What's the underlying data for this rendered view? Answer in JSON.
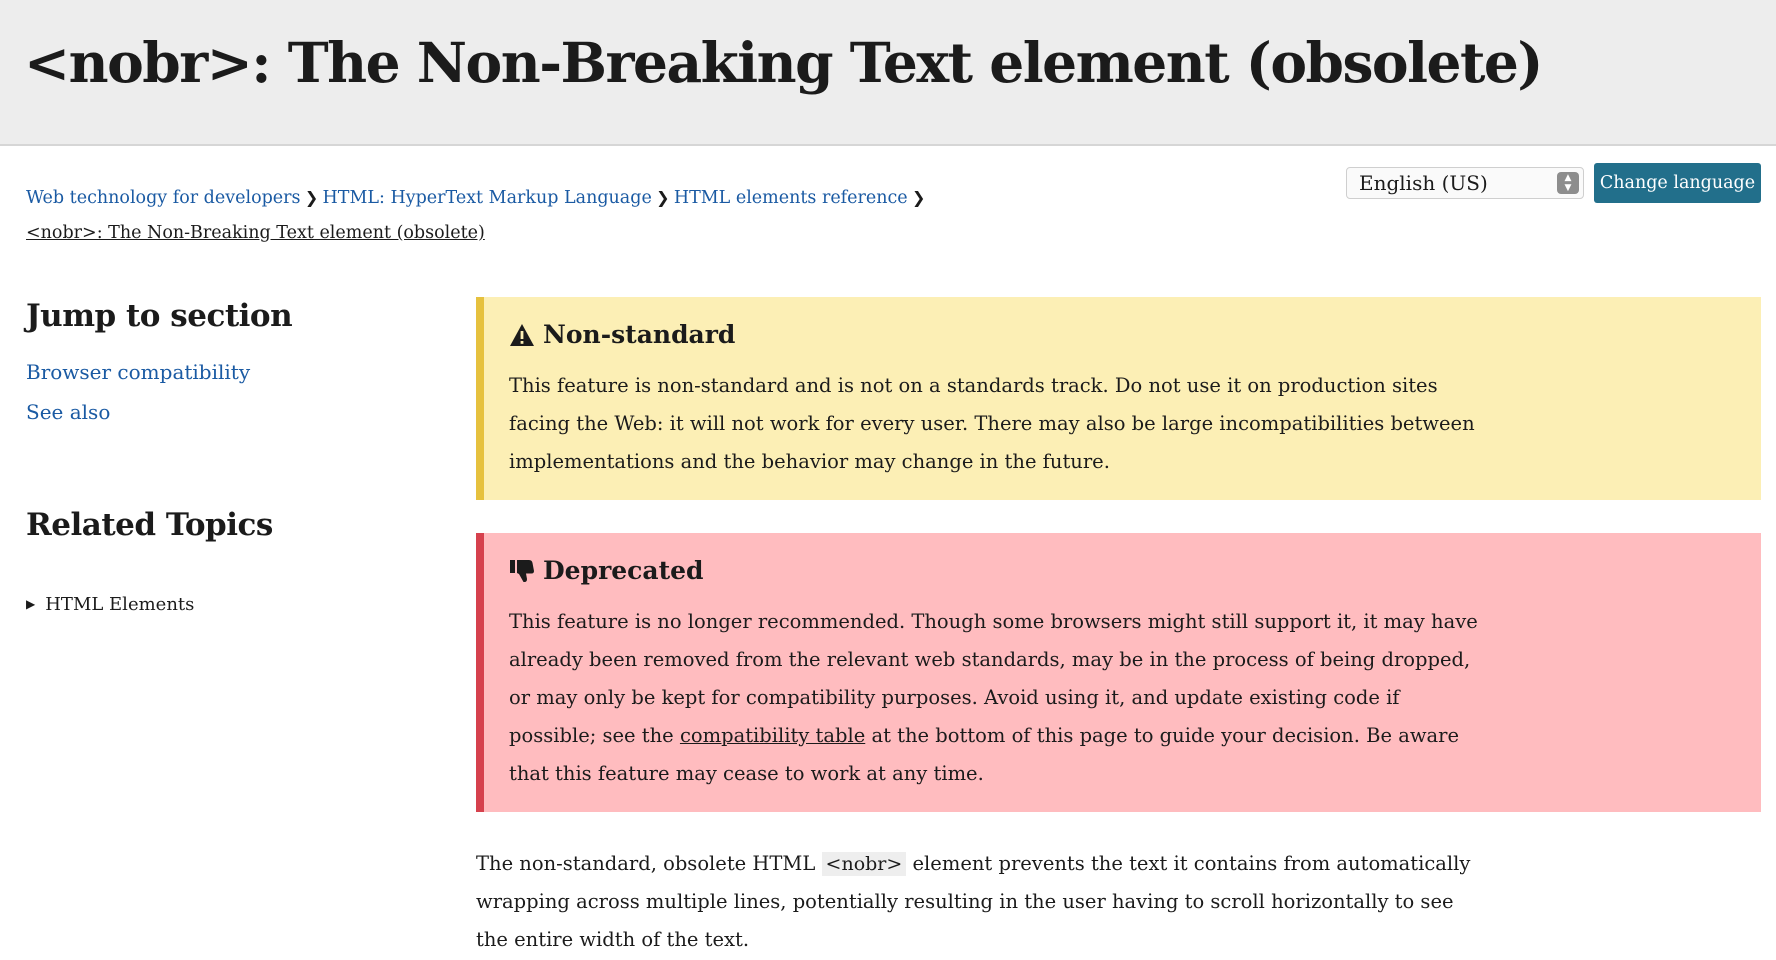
{
  "page": {
    "title": "<nobr>: The Non-Breaking Text element (obsolete)"
  },
  "breadcrumb": {
    "items": [
      "Web technology for developers",
      "HTML: HyperText Markup Language",
      "HTML elements reference"
    ],
    "current": "<nobr>: The Non-Breaking Text element (obsolete)"
  },
  "language": {
    "selected": "English (US)",
    "button_label": "Change language"
  },
  "sidebar": {
    "jump_heading": "Jump to section",
    "jump_links": [
      "Browser compatibility",
      "See also"
    ],
    "related_heading": "Related Topics",
    "related_items": [
      "HTML Elements"
    ]
  },
  "notices": {
    "nonstandard": {
      "title": "Non-standard",
      "icon": "warning-icon",
      "body": "This feature is non-standard and is not on a standards track. Do not use it on production sites facing the Web: it will not work for every user. There may also be large incompatibilities between implementations and the behavior may change in the future."
    },
    "deprecated": {
      "title": "Deprecated",
      "icon": "thumbs-down-icon",
      "body_before": "This feature is no longer recommended. Though some browsers might still support it, it may have already been removed from the relevant web standards, may be in the process of being dropped, or may only be kept for compatibility purposes. Avoid using it, and update existing code if possible; see the",
      "link": "compatibility table",
      "body_after": "at the bottom of this page to guide your decision. Be aware that this feature may cease to work at any time."
    }
  },
  "content": {
    "intro_before": "The non-standard, obsolete HTML",
    "intro_code": "<nobr>",
    "intro_after": "element prevents the text it contains from automatically wrapping across multiple lines, potentially resulting in the user having to scroll horizontally to see the entire width of the text."
  },
  "colors": {
    "title_bar": "#ededed",
    "link": "#1a5aa3",
    "button": "#226f8b",
    "nonstandard_bg": "#fcefb5",
    "nonstandard_border": "#e6c13e",
    "deprecated_bg": "#ffbcbf",
    "deprecated_border": "#d6414d"
  }
}
